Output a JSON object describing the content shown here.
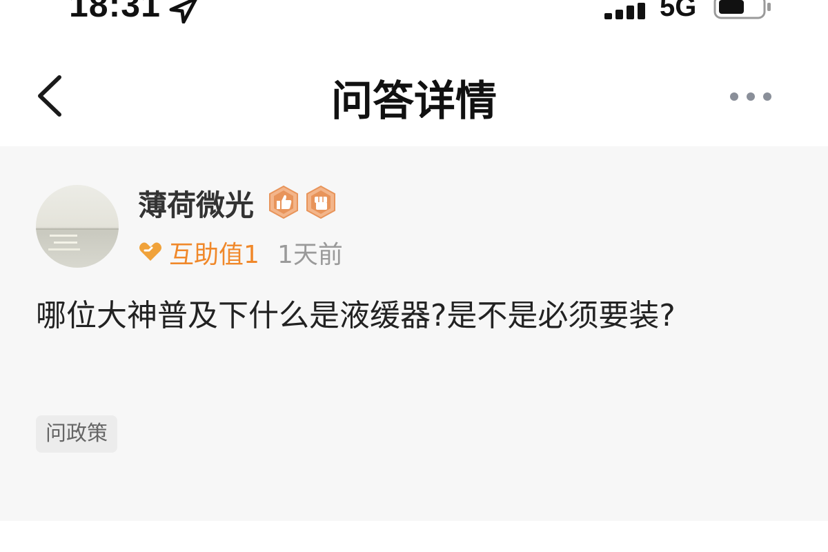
{
  "status_bar": {
    "time": "18:31",
    "network": "5G",
    "icons": [
      "location-arrow-icon",
      "signal-icon",
      "battery-icon"
    ]
  },
  "nav": {
    "title": "问答详情",
    "back_icon": "chevron-left-icon",
    "more_icon": "more-horizontal-icon"
  },
  "question": {
    "author": {
      "name": "薄荷微光",
      "badges": [
        "thumbs-up-badge-icon",
        "fist-badge-icon"
      ]
    },
    "help_value": "互助值1",
    "time_ago": "1天前",
    "text": "哪位大神普及下什么是液缓器?是不是必须要装?",
    "tag": "问政策"
  },
  "colors": {
    "accent": "#f0882a",
    "badge": "#e8945a",
    "card_bg": "#f7f7f7",
    "tag_bg": "#ececec",
    "muted_text": "#9a9a9a"
  }
}
